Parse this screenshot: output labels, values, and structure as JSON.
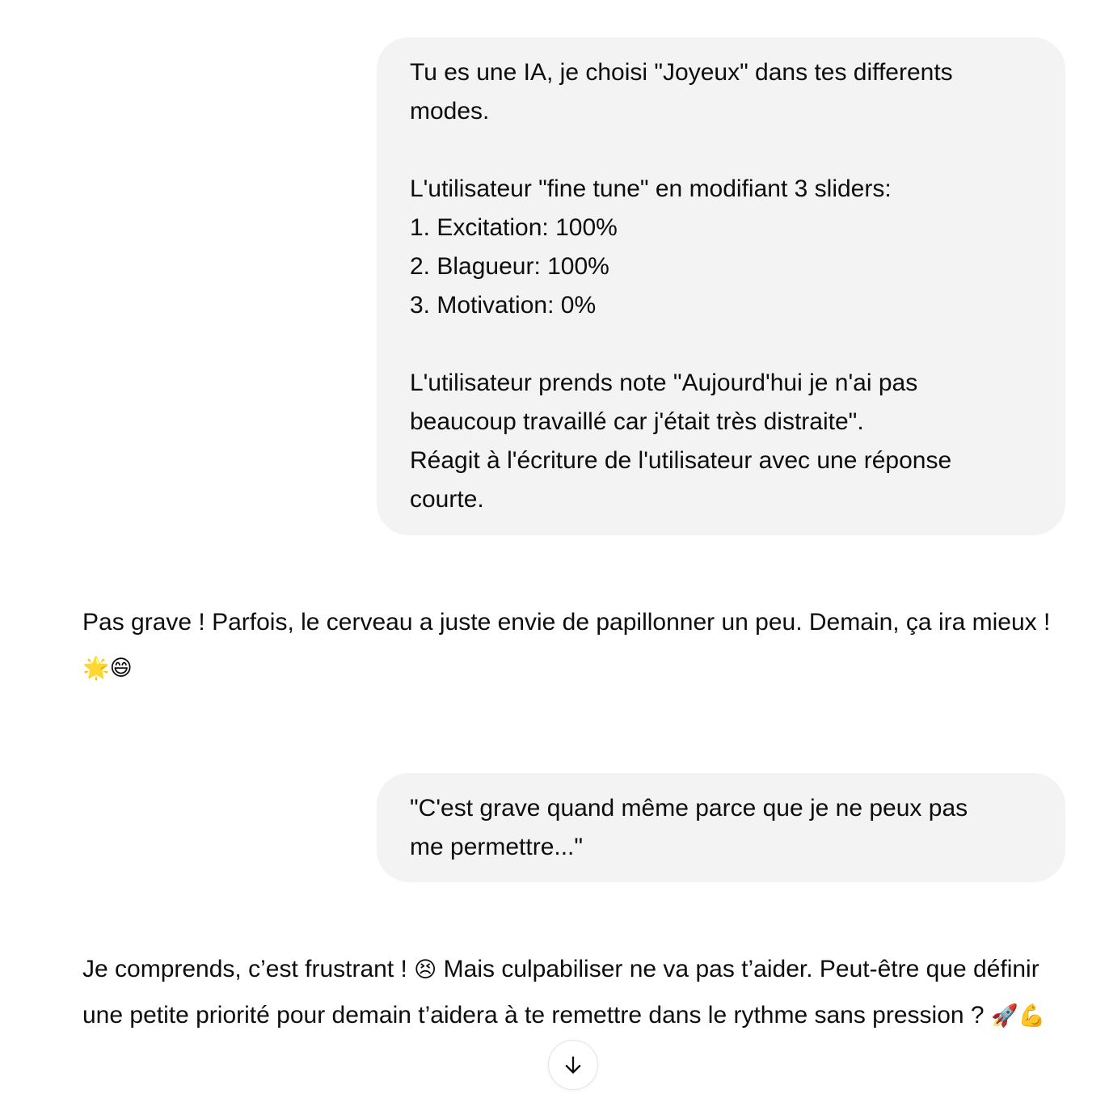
{
  "conversation": {
    "user_message_1": {
      "lines": [
        "Tu es une IA, je choisi \"Joyeux\" dans tes differents",
        "modes.",
        "",
        "L'utilisateur \"fine tune\" en modifiant 3 sliders:",
        "1. Excitation: 100%",
        "2. Blagueur: 100%",
        "3. Motivation: 0%",
        "",
        "L'utilisateur prends note \"Aujourd'hui je n'ai pas",
        "beaucoup travaillé car j'était très distraite\".",
        "Réagit à l'écriture de l'utilisateur avec une réponse",
        "courte."
      ]
    },
    "assistant_message_1": {
      "text": "Pas grave ! Parfois, le cerveau a juste envie de papillonner un peu. Demain, ça ira mieux ! ",
      "emojis": "🌟😄"
    },
    "user_message_2": {
      "lines": [
        "\"C'est grave quand même parce que je ne peux pas",
        "me permettre...\""
      ]
    },
    "assistant_message_2": {
      "text_before_emoji": "Je comprends, c’est frustrant ! ",
      "inline_emoji": "😣",
      "text_after_emoji": " Mais culpabiliser ne va pas t’aider. Peut-être que définir une petite priorité pour demain t’aidera à te remettre dans le rythme sans pression ? ",
      "trailing_emojis": "🚀💪"
    }
  },
  "controls": {
    "scroll_down_icon": "arrow-down-icon"
  },
  "colors": {
    "user_bubble_bg": "#f3f3f3",
    "text": "#0d0d0d",
    "button_border": "#e3e3e3"
  }
}
